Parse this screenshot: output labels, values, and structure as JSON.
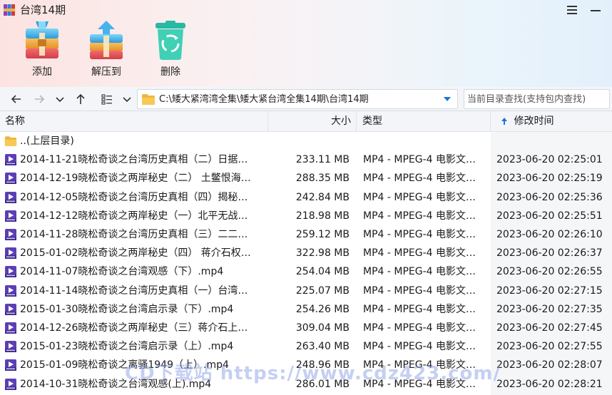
{
  "window": {
    "title": "台湾14期",
    "icon": "winrar-books-icon",
    "menu_icon": "hamburger-menu-icon",
    "minimize_icon": "minimize-icon"
  },
  "toolbar": {
    "add_label": "添加",
    "extract_label": "解压到",
    "delete_label": "删除"
  },
  "navigation": {
    "back_icon": "arrow-left-icon",
    "forward_icon": "arrow-right-icon",
    "history_icon": "chevron-down-icon",
    "up_icon": "arrow-up-icon",
    "view_icon": "list-view-icon",
    "path": "C:\\矮大紧湾湾全集\\矮大紧台湾全集14期\\台湾14期",
    "search_placeholder": "当前目录查找(支持包内查找)"
  },
  "columns": {
    "name": "名称",
    "size": "大小",
    "type": "类型",
    "mtime": "修改时间"
  },
  "parent_row": {
    "name": "..(上层目录)"
  },
  "files": [
    {
      "name": "2014-11-21晓松奇谈之台湾历史真相（二）日据…",
      "size": "233.11 MB",
      "type": "MP4 - MPEG-4 电影文…",
      "mtime": "2023-06-20 02:25:01"
    },
    {
      "name": "2014-12-19晓松奇谈之两岸秘史（二） 土鳖恨海…",
      "size": "288.35 MB",
      "type": "MP4 - MPEG-4 电影文…",
      "mtime": "2023-06-20 02:25:19"
    },
    {
      "name": "2014-12-05晓松奇谈之台湾历史真相（四）揭秘…",
      "size": "242.84 MB",
      "type": "MP4 - MPEG-4 电影文…",
      "mtime": "2023-06-20 02:25:36"
    },
    {
      "name": "2014-12-12晓松奇谈之两岸秘史（一）北平无战…",
      "size": "218.98 MB",
      "type": "MP4 - MPEG-4 电影文…",
      "mtime": "2023-06-20 02:25:51"
    },
    {
      "name": "2014-11-28晓松奇谈之台湾历史真相（三）二二…",
      "size": "259.12 MB",
      "type": "MP4 - MPEG-4 电影文…",
      "mtime": "2023-06-20 02:26:10"
    },
    {
      "name": "2015-01-02晓松奇谈之两岸秘史（四） 蒋介石权…",
      "size": "322.98 MB",
      "type": "MP4 - MPEG-4 电影文…",
      "mtime": "2023-06-20 02:26:37"
    },
    {
      "name": "2014-11-07晓松奇谈之台湾观感（下）.mp4",
      "size": "254.04 MB",
      "type": "MP4 - MPEG-4 电影文…",
      "mtime": "2023-06-20 02:26:55"
    },
    {
      "name": "2014-11-14晓松奇谈之台湾历史真相（一）台湾…",
      "size": "225.07 MB",
      "type": "MP4 - MPEG-4 电影文…",
      "mtime": "2023-06-20 02:27:15"
    },
    {
      "name": "2015-01-30晓松奇谈之台湾启示录（下）.mp4",
      "size": "254.26 MB",
      "type": "MP4 - MPEG-4 电影文…",
      "mtime": "2023-06-20 02:27:35"
    },
    {
      "name": "2014-12-26晓松奇谈之两岸秘史（三）蒋介石上…",
      "size": "309.04 MB",
      "type": "MP4 - MPEG-4 电影文…",
      "mtime": "2023-06-20 02:27:45"
    },
    {
      "name": "2015-01-23晓松奇谈之台湾启示录（上）.mp4",
      "size": "263.40 MB",
      "type": "MP4 - MPEG-4 电影文…",
      "mtime": "2023-06-20 02:27:55"
    },
    {
      "name": "2015-01-09晓松奇谈之离骚1949（上）.mp4",
      "size": "248.96 MB",
      "type": "MP4 - MPEG-4 电影文…",
      "mtime": "2023-06-20 02:28:07"
    },
    {
      "name": "2014-10-31晓松奇谈之台湾观感(上).mp4",
      "size": "286.01 MB",
      "type": "MP4 - MPEG-4 电影文…",
      "mtime": "2023-06-20 02:28:21"
    }
  ],
  "watermark": "CD下载站 https://www.cdz423.com/",
  "colors": {
    "accent": "#1677d2",
    "mp4_icon": "#5b3fb5",
    "folder": "#f2b53c"
  }
}
